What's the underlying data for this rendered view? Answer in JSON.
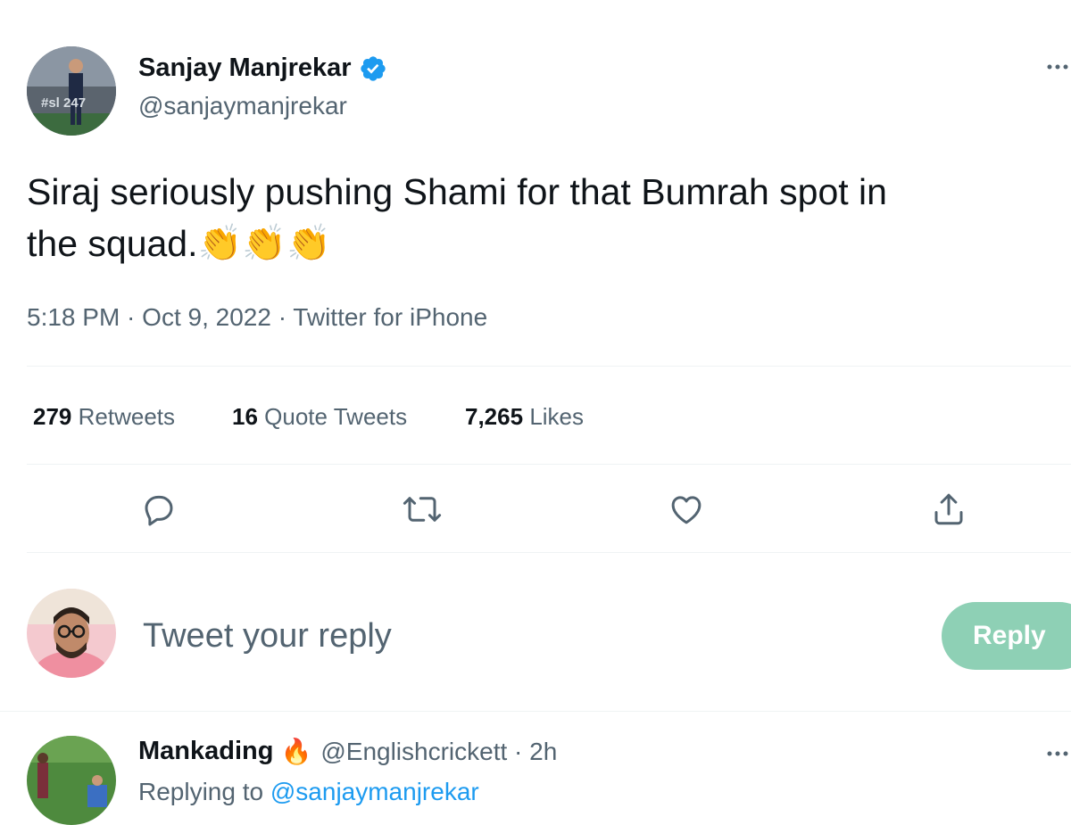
{
  "tweet": {
    "author": {
      "name": "Sanjay Manjrekar",
      "handle": "@sanjaymanjrekar",
      "verified": true,
      "avatar_overlay_text": "#sl 247"
    },
    "text_line1": "Siraj seriously pushing Shami for that Bumrah spot in",
    "text_line2": "the squad.",
    "emoji": "👏👏👏",
    "meta": "5:18 PM · Oct 9, 2022 · Twitter for iPhone",
    "stats": {
      "retweets_count": "279",
      "retweets_label": "Retweets",
      "quotes_count": "16",
      "quotes_label": "Quote Tweets",
      "likes_count": "7,265",
      "likes_label": "Likes"
    },
    "actions": [
      "reply-icon",
      "retweet-icon",
      "like-icon",
      "share-icon"
    ]
  },
  "compose": {
    "placeholder": "Tweet your reply",
    "button_label": "Reply"
  },
  "reply": {
    "name": "Mankading",
    "emoji": "🔥",
    "handle_time": "@Englishcrickett · 2h",
    "replying_prefix": "Replying to",
    "replying_handle": "@sanjaymanjrekar"
  },
  "colors": {
    "accent": "#1d9bf0",
    "reply_button": "#8ed0b5",
    "text": "#0f1419",
    "secondary_text": "#536471",
    "divider": "#eff3f4"
  }
}
